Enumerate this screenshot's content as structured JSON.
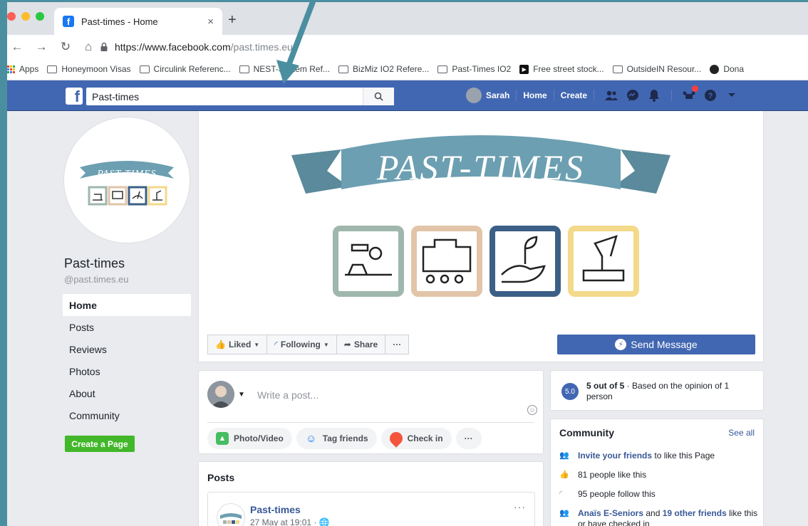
{
  "browser": {
    "tab_title": "Past-times - Home",
    "tab_close": "×",
    "new_tab": "+",
    "url_host": "https://www.facebook.com",
    "url_path": "/past.times.eu/",
    "bookmarks": [
      {
        "label": "Apps",
        "type": "apps"
      },
      {
        "label": "Honeymoon Visas",
        "type": "folder"
      },
      {
        "label": "Circulink Referenc...",
        "type": "folder"
      },
      {
        "label": "NEST-System Ref...",
        "type": "folder"
      },
      {
        "label": "BizMiz IO2 Refere...",
        "type": "folder"
      },
      {
        "label": "Past-Times IO2",
        "type": "folder"
      },
      {
        "label": "Free street stock...",
        "type": "page"
      },
      {
        "label": "OutsideIN Resour...",
        "type": "folder"
      },
      {
        "label": "Dona",
        "type": "page"
      }
    ]
  },
  "fb": {
    "search_value": "Past-times",
    "user_name": "Sarah",
    "nav_home": "Home",
    "nav_create": "Create"
  },
  "page": {
    "name": "Past-times",
    "handle": "@past.times.eu",
    "left_nav": [
      "Home",
      "Posts",
      "Reviews",
      "Photos",
      "About",
      "Community"
    ],
    "active_nav": "Home",
    "create_page": "Create a Page",
    "cover_banner_text": "PAST-TIMES"
  },
  "actions": {
    "liked": "Liked",
    "following": "Following",
    "share": "Share",
    "more": "···",
    "send_message": "Send Message"
  },
  "composer": {
    "placeholder": "Write a post...",
    "photo_video": "Photo/Video",
    "tag_friends": "Tag friends",
    "check_in": "Check in",
    "more": "···"
  },
  "posts": {
    "title": "Posts",
    "author": "Past-times",
    "date": "27 May at 19:01 ·",
    "more": "···"
  },
  "rating": {
    "badge": "5.0",
    "bold": "5 out of 5",
    "rest": " · Based on the opinion of 1 person"
  },
  "community": {
    "title": "Community",
    "see_all": "See all",
    "invite_link": "Invite your friends",
    "invite_rest": " to like this Page",
    "likes": "81 people like this",
    "follows": "95 people follow this",
    "friend_link": "Anaïs E-Seniors",
    "friend_mid": " and ",
    "friend_others": "19 other friends",
    "friend_rest": " like this or have checked in"
  },
  "colors": {
    "fb_blue": "#4267b2",
    "link_blue": "#385898",
    "create_green": "#42b72a",
    "arrow_teal": "#4a8fa0",
    "banner_blue": "#6c9fb1"
  }
}
